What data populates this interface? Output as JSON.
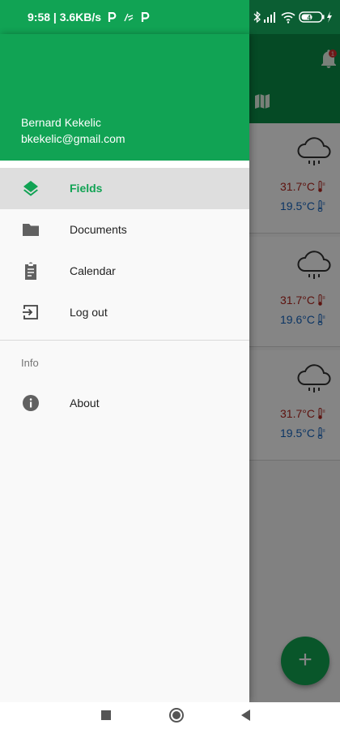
{
  "status_bar": {
    "time_text": "9:58 | 3.6KB/s",
    "left_icons": [
      "parking-icon",
      "notification-icon",
      "parking-icon"
    ],
    "right_icons": [
      "bluetooth-icon",
      "signal-icon",
      "wifi-icon",
      "battery-icon"
    ],
    "battery_level": "47",
    "color": "#11a354"
  },
  "drawer": {
    "user_name": "Bernard Kekelic",
    "user_email": "bkekelic@gmail.com",
    "accent_color": "#11a354",
    "items": [
      {
        "label": "Fields",
        "icon": "layers-icon",
        "active": true
      },
      {
        "label": "Documents",
        "icon": "folder-icon",
        "active": false
      },
      {
        "label": "Calendar",
        "icon": "clipboard-icon",
        "active": false
      },
      {
        "label": "Log out",
        "icon": "logout-icon",
        "active": false
      }
    ],
    "section_label": "Info",
    "info_items": [
      {
        "label": "About",
        "icon": "info-icon"
      }
    ]
  },
  "background": {
    "header_color": "#0b8f47",
    "notification_badge": "1",
    "cards": [
      {
        "icon": "rain-cloud-icon",
        "max_temp": "31.7°C",
        "min_temp": "19.5°C"
      },
      {
        "icon": "rain-cloud-icon",
        "max_temp": "31.7°C",
        "min_temp": "19.6°C"
      },
      {
        "icon": "rain-cloud-icon",
        "max_temp": "31.7°C",
        "min_temp": "19.5°C"
      }
    ],
    "fab_label": "+"
  },
  "system_nav": {
    "buttons": [
      "recents-button",
      "home-button",
      "back-button"
    ]
  }
}
